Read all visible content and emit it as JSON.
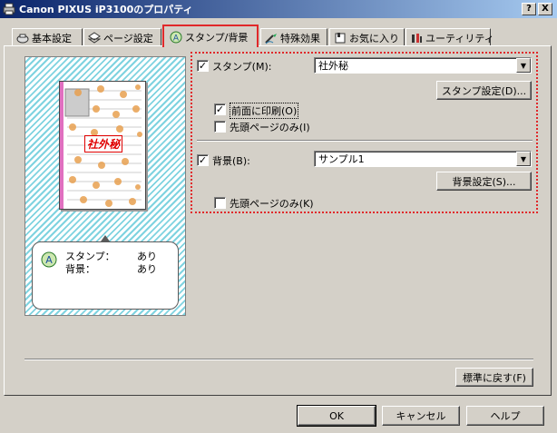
{
  "window": {
    "title": "Canon PIXUS iP3100のプロパティ",
    "help_btn": "?",
    "close_btn": "X"
  },
  "tabs": [
    {
      "label": "基本設定",
      "icon": "basic-settings-icon"
    },
    {
      "label": "ページ設定",
      "icon": "page-settings-icon"
    },
    {
      "label": "スタンプ/背景",
      "icon": "stamp-icon",
      "active": true
    },
    {
      "label": "特殊効果",
      "icon": "special-effects-icon"
    },
    {
      "label": "お気に入り",
      "icon": "favorites-icon"
    },
    {
      "label": "ユーティリティ",
      "icon": "utility-icon"
    }
  ],
  "preview": {
    "stamp_text": "社外秘",
    "summary": {
      "stamp_label": "スタンプ：",
      "stamp_value": "あり",
      "background_label": "背景：",
      "background_value": "あり"
    }
  },
  "stamp": {
    "checkbox_label": "スタンプ(M):",
    "checked": true,
    "selected": "社外秘",
    "settings_button": "スタンプ設定(D)...",
    "print_front_label": "前面に印刷(O)",
    "print_front_checked": true,
    "first_page_label": "先頭ページのみ(I)",
    "first_page_checked": false
  },
  "background": {
    "checkbox_label": "背景(B):",
    "checked": true,
    "selected": "サンプル1",
    "settings_button": "背景設定(S)...",
    "first_page_label": "先頭ページのみ(K)",
    "first_page_checked": false
  },
  "footer": {
    "restore_button": "標準に戻す(F)",
    "ok_button": "OK",
    "cancel_button": "キャンセル",
    "help_button": "ヘルプ"
  },
  "colors": {
    "titlebar": "#0a246a",
    "highlight": "#e0282a",
    "stamp": "#e00000"
  }
}
